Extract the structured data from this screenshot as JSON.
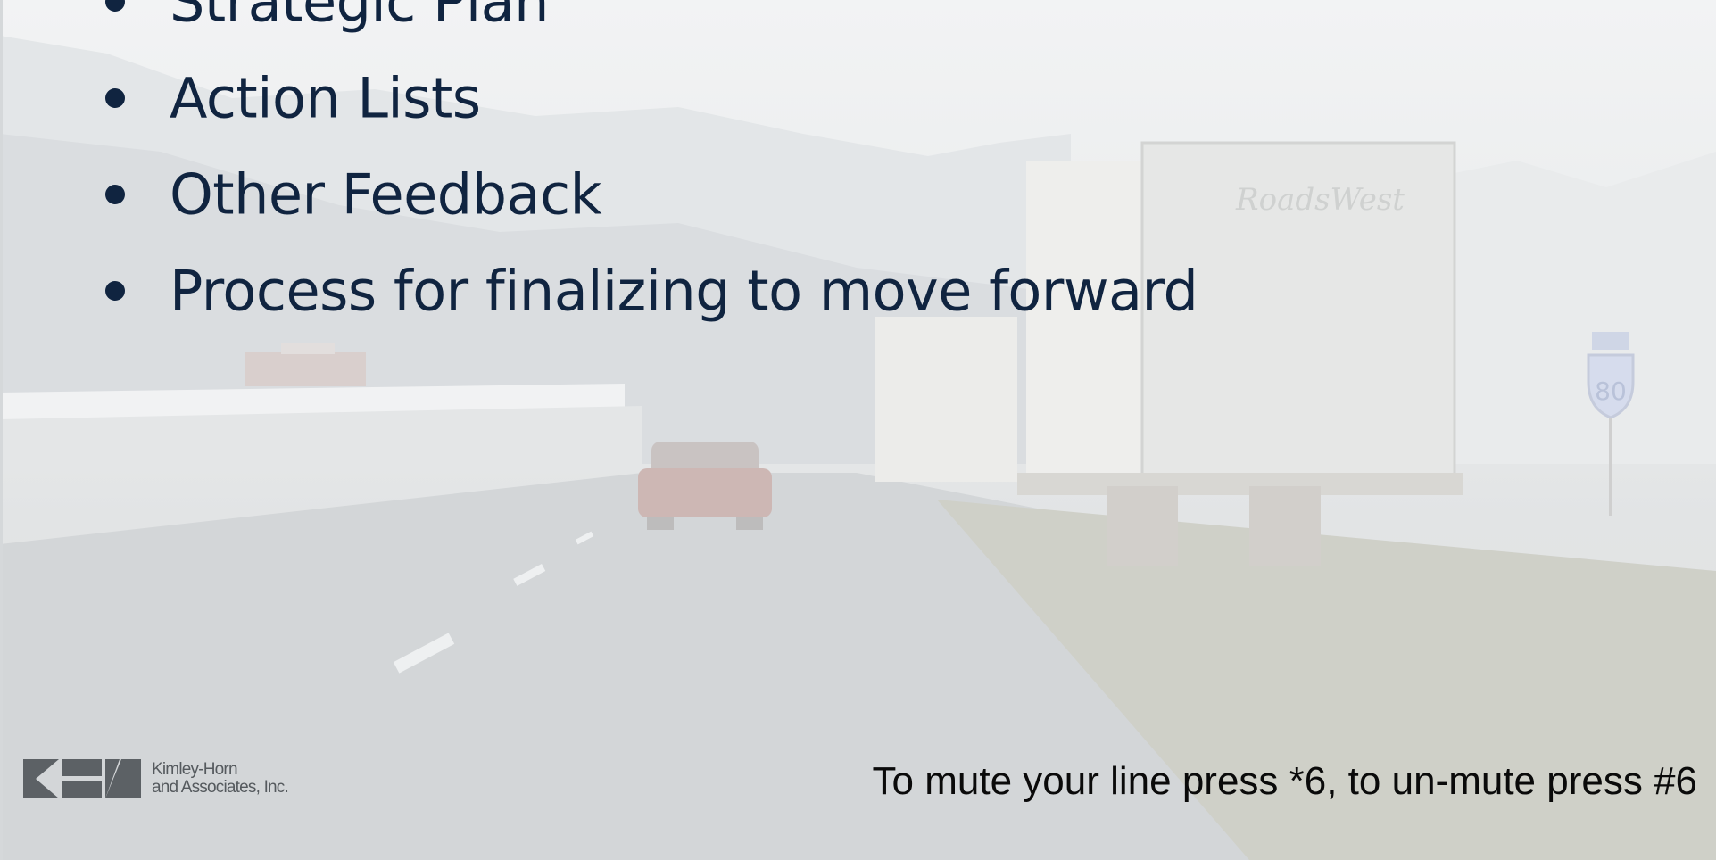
{
  "slide": {
    "bullets": [
      {
        "text": "Strategic Plan"
      },
      {
        "text": "Action Lists"
      },
      {
        "text": "Other Feedback"
      },
      {
        "text": "Process for finalizing to move forward"
      }
    ],
    "logo": {
      "line1": "Kimley-Horn",
      "line2": "and Associates, Inc."
    },
    "mute_note": "To mute your line press *6, to un-mute press #6",
    "truck_brand": "RoadsWest",
    "highway_sign": "80"
  },
  "colors": {
    "bullet_text": "#102440",
    "footer_text": "#0a0a0a",
    "logo_gray": "#555a5e"
  }
}
